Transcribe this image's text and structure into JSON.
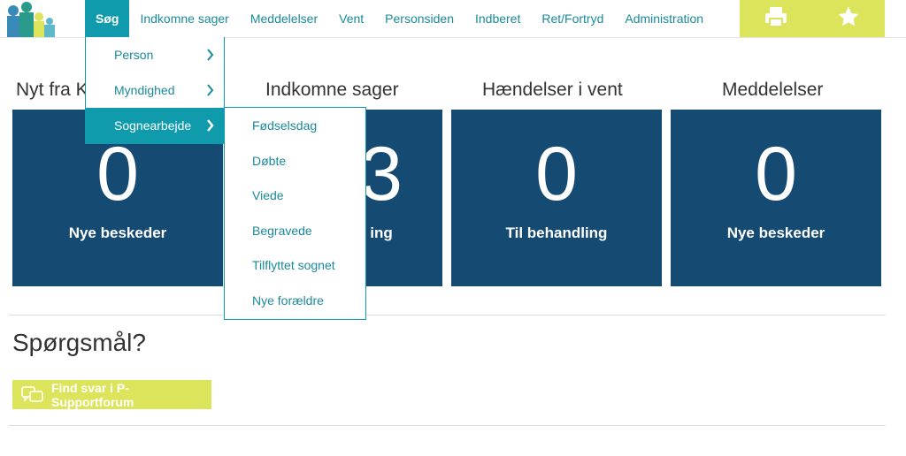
{
  "nav": {
    "items": [
      {
        "label": "Søg",
        "active": true
      },
      {
        "label": "Indkomne sager"
      },
      {
        "label": "Meddelelser"
      },
      {
        "label": "Vent"
      },
      {
        "label": "Personsiden"
      },
      {
        "label": "Indberet"
      },
      {
        "label": "Ret/Fortryd"
      },
      {
        "label": "Administration"
      }
    ],
    "print_icon": "printer-icon",
    "favorite_icon": "star-icon"
  },
  "search_menu": {
    "items": [
      {
        "label": "Person"
      },
      {
        "label": "Myndighed"
      },
      {
        "label": "Sognearbejde",
        "active": true
      }
    ],
    "submenu": [
      {
        "label": "Fødselsdag"
      },
      {
        "label": "Døbte"
      },
      {
        "label": "Viede"
      },
      {
        "label": "Begravede"
      },
      {
        "label": "Tilflyttet sognet"
      },
      {
        "label": "Nye forældre"
      }
    ]
  },
  "tiles": [
    {
      "heading": "Nyt fra K",
      "value": "0",
      "label": "Nye beskeder"
    },
    {
      "heading": "Indkomne sager",
      "value": "3",
      "label": "ing"
    },
    {
      "heading": "Hændelser i vent",
      "value": "0",
      "label": "Til behandling"
    },
    {
      "heading": "Meddelelser",
      "value": "0",
      "label": "Nye beskeder"
    }
  ],
  "questions": {
    "title": "Spørgsmål?",
    "button_label": "Find svar i P-Supportforum"
  },
  "colors": {
    "tile_bg": "#154a72",
    "accent": "#0f9bab",
    "yellow": "#dbe45a"
  }
}
